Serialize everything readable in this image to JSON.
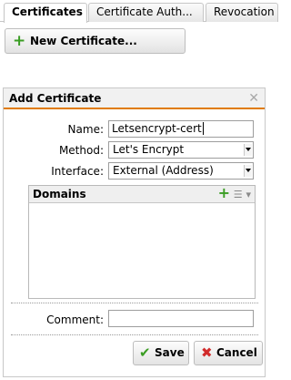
{
  "tabs": [
    {
      "label": "Certificates"
    },
    {
      "label": "Certificate Auth..."
    },
    {
      "label": "Revocation"
    }
  ],
  "new_certificate_button": {
    "label": "New Certificate..."
  },
  "dialog": {
    "title": "Add Certificate",
    "name_label": "Name:",
    "name_value": "Letsencrypt-cert",
    "method_label": "Method:",
    "method_value": "Let's Encrypt",
    "interface_label": "Interface:",
    "interface_value": "External (Address)",
    "domains_title": "Domains",
    "comment_label": "Comment:",
    "comment_value": "",
    "save_label": "Save",
    "cancel_label": "Cancel"
  },
  "icons": {
    "add": "plus-icon",
    "list": "list-icon",
    "close": "close-icon",
    "save": "checkmark-icon",
    "cancel": "x-icon"
  },
  "colors": {
    "accent_orange": "#e07b00",
    "add_green": "#3a9d23",
    "cancel_red": "#d12b2b"
  }
}
